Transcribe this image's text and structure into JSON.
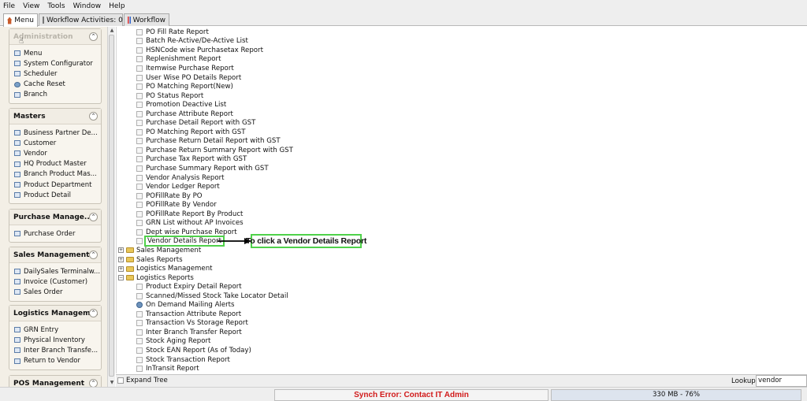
{
  "menubar": {
    "items": [
      "File",
      "View",
      "Tools",
      "Window",
      "Help"
    ]
  },
  "tabs": [
    {
      "label": "Menu",
      "icon": "home-icon",
      "active": true
    },
    {
      "label": "Workflow Activities: 0",
      "icon": "window-icon",
      "active": false
    },
    {
      "label": "Workflow",
      "icon": "workflow-icon",
      "active": false
    }
  ],
  "sidebar": {
    "panels": [
      {
        "title": "Administration",
        "disabled": true,
        "items": [
          "Menu",
          "System Configurator",
          "Scheduler",
          "Cache Reset",
          "Branch"
        ]
      },
      {
        "title": "Masters",
        "disabled": false,
        "items": [
          "Business Partner De...",
          "Customer",
          "Vendor",
          "HQ Product Master",
          "Branch Product Mas...",
          "Product Department",
          "Product Detail"
        ]
      },
      {
        "title": "Purchase Manage...",
        "disabled": false,
        "items": [
          "Purchase Order"
        ]
      },
      {
        "title": "Sales Management",
        "disabled": false,
        "items": [
          "DailySales Terminalw...",
          "Invoice (Customer)",
          "Sales Order"
        ]
      },
      {
        "title": "Logistics Managem...",
        "disabled": false,
        "items": [
          "GRN Entry",
          "Physical Inventory",
          "Inter Branch Transfe...",
          "Return to Vendor"
        ]
      },
      {
        "title": "POS Management",
        "disabled": false,
        "items": []
      }
    ]
  },
  "tree": {
    "purchase_reports": [
      "PO Fill Rate Report",
      "Batch Re-Active/De-Active List",
      "HSNCode wise Purchasetax Report",
      "Replenishment Report",
      "Itemwise Purchase Report",
      "User Wise PO Details Report",
      "PO Matching Report(New)",
      "PO Status Report",
      "Promotion Deactive List",
      "Purchase Attribute Report",
      "Purchase Detail Report with GST",
      "PO Matching Report with GST",
      "Purchase Return Detail Report with GST",
      "Purchase Return Summary Report with GST",
      "Purchase Tax Report with GST",
      "Purchase Summary Report with GST",
      "Vendor Analysis Report",
      "Vendor Ledger Report",
      "POFillRate By PO",
      "POFillRate By Vendor",
      "POFillRate Report By Product",
      "GRN List without AP Invoices",
      "Dept wise Purchase Report",
      "Vendor Details Report"
    ],
    "folders": [
      "Sales Management",
      "Sales Reports",
      "Logistics Management",
      "Logistics Reports"
    ],
    "logistics_reports": [
      "Product Expiry Detail Report",
      "Scanned/Missed Stock Take Locator Detail",
      "On Demand Mailing Alerts",
      "Transaction Attribute Report",
      "Transaction Vs Storage Report",
      "Inter Branch Transfer Report",
      "Stock Aging Report",
      "Stock EAN Report (As of Today)",
      "Stock Transaction Report",
      "InTransit Report"
    ],
    "highlighted_item": "Vendor Details Report"
  },
  "annotation": {
    "text": "To click a Vendor Details Report",
    "color": "#4fd14a"
  },
  "bottombar": {
    "expand_label": "Expand Tree",
    "lookup_label": "Lookup",
    "lookup_value": "vendor"
  },
  "status": {
    "error": "Synch Error: Contact IT Admin",
    "memory": "330 MB - 76%",
    "error_color": "#d11a1a"
  }
}
